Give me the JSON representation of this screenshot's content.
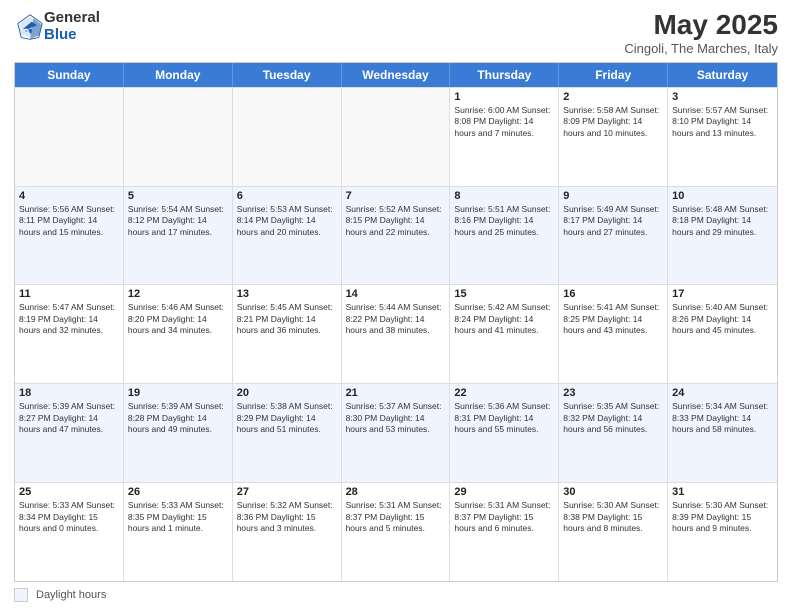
{
  "logo": {
    "general": "General",
    "blue": "Blue"
  },
  "title": "May 2025",
  "location": "Cingoli, The Marches, Italy",
  "header_days": [
    "Sunday",
    "Monday",
    "Tuesday",
    "Wednesday",
    "Thursday",
    "Friday",
    "Saturday"
  ],
  "footer": {
    "legend_label": "Daylight hours"
  },
  "rows": [
    {
      "cells": [
        {
          "day": "",
          "info": "",
          "empty": true
        },
        {
          "day": "",
          "info": "",
          "empty": true
        },
        {
          "day": "",
          "info": "",
          "empty": true
        },
        {
          "day": "",
          "info": "",
          "empty": true
        },
        {
          "day": "1",
          "info": "Sunrise: 6:00 AM\nSunset: 8:08 PM\nDaylight: 14 hours\nand 7 minutes.",
          "empty": false
        },
        {
          "day": "2",
          "info": "Sunrise: 5:58 AM\nSunset: 8:09 PM\nDaylight: 14 hours\nand 10 minutes.",
          "empty": false
        },
        {
          "day": "3",
          "info": "Sunrise: 5:57 AM\nSunset: 8:10 PM\nDaylight: 14 hours\nand 13 minutes.",
          "empty": false
        }
      ]
    },
    {
      "cells": [
        {
          "day": "4",
          "info": "Sunrise: 5:56 AM\nSunset: 8:11 PM\nDaylight: 14 hours\nand 15 minutes.",
          "empty": false
        },
        {
          "day": "5",
          "info": "Sunrise: 5:54 AM\nSunset: 8:12 PM\nDaylight: 14 hours\nand 17 minutes.",
          "empty": false
        },
        {
          "day": "6",
          "info": "Sunrise: 5:53 AM\nSunset: 8:14 PM\nDaylight: 14 hours\nand 20 minutes.",
          "empty": false
        },
        {
          "day": "7",
          "info": "Sunrise: 5:52 AM\nSunset: 8:15 PM\nDaylight: 14 hours\nand 22 minutes.",
          "empty": false
        },
        {
          "day": "8",
          "info": "Sunrise: 5:51 AM\nSunset: 8:16 PM\nDaylight: 14 hours\nand 25 minutes.",
          "empty": false
        },
        {
          "day": "9",
          "info": "Sunrise: 5:49 AM\nSunset: 8:17 PM\nDaylight: 14 hours\nand 27 minutes.",
          "empty": false
        },
        {
          "day": "10",
          "info": "Sunrise: 5:48 AM\nSunset: 8:18 PM\nDaylight: 14 hours\nand 29 minutes.",
          "empty": false
        }
      ]
    },
    {
      "cells": [
        {
          "day": "11",
          "info": "Sunrise: 5:47 AM\nSunset: 8:19 PM\nDaylight: 14 hours\nand 32 minutes.",
          "empty": false
        },
        {
          "day": "12",
          "info": "Sunrise: 5:46 AM\nSunset: 8:20 PM\nDaylight: 14 hours\nand 34 minutes.",
          "empty": false
        },
        {
          "day": "13",
          "info": "Sunrise: 5:45 AM\nSunset: 8:21 PM\nDaylight: 14 hours\nand 36 minutes.",
          "empty": false
        },
        {
          "day": "14",
          "info": "Sunrise: 5:44 AM\nSunset: 8:22 PM\nDaylight: 14 hours\nand 38 minutes.",
          "empty": false
        },
        {
          "day": "15",
          "info": "Sunrise: 5:42 AM\nSunset: 8:24 PM\nDaylight: 14 hours\nand 41 minutes.",
          "empty": false
        },
        {
          "day": "16",
          "info": "Sunrise: 5:41 AM\nSunset: 8:25 PM\nDaylight: 14 hours\nand 43 minutes.",
          "empty": false
        },
        {
          "day": "17",
          "info": "Sunrise: 5:40 AM\nSunset: 8:26 PM\nDaylight: 14 hours\nand 45 minutes.",
          "empty": false
        }
      ]
    },
    {
      "cells": [
        {
          "day": "18",
          "info": "Sunrise: 5:39 AM\nSunset: 8:27 PM\nDaylight: 14 hours\nand 47 minutes.",
          "empty": false
        },
        {
          "day": "19",
          "info": "Sunrise: 5:39 AM\nSunset: 8:28 PM\nDaylight: 14 hours\nand 49 minutes.",
          "empty": false
        },
        {
          "day": "20",
          "info": "Sunrise: 5:38 AM\nSunset: 8:29 PM\nDaylight: 14 hours\nand 51 minutes.",
          "empty": false
        },
        {
          "day": "21",
          "info": "Sunrise: 5:37 AM\nSunset: 8:30 PM\nDaylight: 14 hours\nand 53 minutes.",
          "empty": false
        },
        {
          "day": "22",
          "info": "Sunrise: 5:36 AM\nSunset: 8:31 PM\nDaylight: 14 hours\nand 55 minutes.",
          "empty": false
        },
        {
          "day": "23",
          "info": "Sunrise: 5:35 AM\nSunset: 8:32 PM\nDaylight: 14 hours\nand 56 minutes.",
          "empty": false
        },
        {
          "day": "24",
          "info": "Sunrise: 5:34 AM\nSunset: 8:33 PM\nDaylight: 14 hours\nand 58 minutes.",
          "empty": false
        }
      ]
    },
    {
      "cells": [
        {
          "day": "25",
          "info": "Sunrise: 5:33 AM\nSunset: 8:34 PM\nDaylight: 15 hours\nand 0 minutes.",
          "empty": false
        },
        {
          "day": "26",
          "info": "Sunrise: 5:33 AM\nSunset: 8:35 PM\nDaylight: 15 hours\nand 1 minute.",
          "empty": false
        },
        {
          "day": "27",
          "info": "Sunrise: 5:32 AM\nSunset: 8:36 PM\nDaylight: 15 hours\nand 3 minutes.",
          "empty": false
        },
        {
          "day": "28",
          "info": "Sunrise: 5:31 AM\nSunset: 8:37 PM\nDaylight: 15 hours\nand 5 minutes.",
          "empty": false
        },
        {
          "day": "29",
          "info": "Sunrise: 5:31 AM\nSunset: 8:37 PM\nDaylight: 15 hours\nand 6 minutes.",
          "empty": false
        },
        {
          "day": "30",
          "info": "Sunrise: 5:30 AM\nSunset: 8:38 PM\nDaylight: 15 hours\nand 8 minutes.",
          "empty": false
        },
        {
          "day": "31",
          "info": "Sunrise: 5:30 AM\nSunset: 8:39 PM\nDaylight: 15 hours\nand 9 minutes.",
          "empty": false
        }
      ]
    }
  ]
}
